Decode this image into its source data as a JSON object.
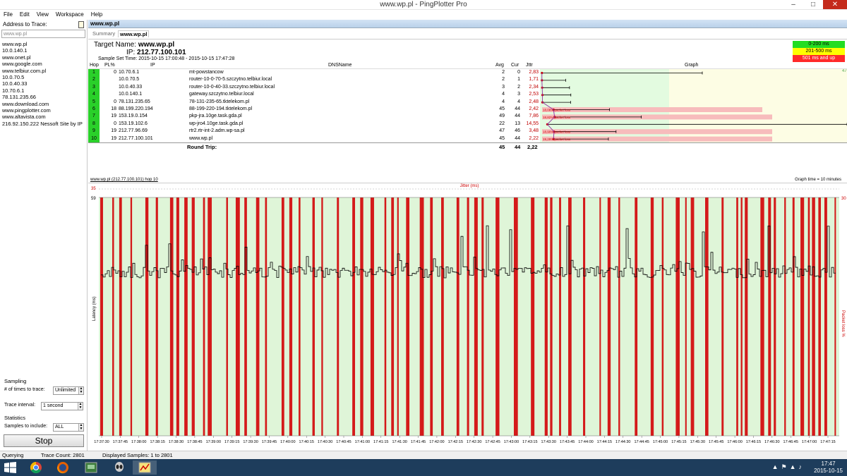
{
  "window": {
    "title": "www.wp.pl - PingPlotter Pro"
  },
  "menu": [
    "File",
    "Edit",
    "View",
    "Workspace",
    "Help"
  ],
  "left": {
    "header": "Address to Trace:",
    "address_value": "www.wp.pl",
    "history": [
      "www.wp.pl",
      "10.0.140.1",
      "www.onet.pl",
      "www.google.com",
      "www.telbiur.com.pl",
      "10.0.70.5",
      "10.0.40.33",
      "10.70.6.1",
      "78.131.235.66",
      "www.download.com",
      "www.pingplotter.com",
      "www.altavista.com",
      "216.92.150.222 Nessoft Site by IP"
    ],
    "sampling_label": "Sampling",
    "times_label": "# of times to trace:",
    "times_value": "Unlimited",
    "interval_label": "Trace interval:",
    "interval_value": "1 second",
    "statistics_label": "Statistics",
    "samples_label": "Samples to include:",
    "samples_value": "ALL",
    "stop_label": "Stop"
  },
  "main": {
    "tab_title": "www.wp.pl",
    "subtab_summary": "Summary",
    "subtab_target": "www.wp.pl",
    "target_name_label": "Target Name:",
    "target_name": "www.wp.pl",
    "ip_label": "IP:",
    "ip": "212.77.100.101",
    "sample_set_label": "Sample Set Time:",
    "sample_set_time": "2015-10-15 17:00:48 - 2015-10-15 17:47:28",
    "legend": [
      {
        "label": "0-200 ms",
        "color": "#22dd22"
      },
      {
        "label": "201-500 ms",
        "color": "#ffff00"
      },
      {
        "label": "501 ms and up",
        "color": "#ff2a2a"
      }
    ],
    "columns": {
      "hop": "Hop",
      "pl": "PL%",
      "ip": "IP",
      "dns": "DNSName",
      "avg": "Avg",
      "cur": "Cur",
      "jttr": "Jttr",
      "graph": "Graph"
    },
    "graph_scale_max": "471",
    "hops": [
      {
        "hop": "1",
        "pl": "0",
        "ip": "10.70.6.1",
        "dns": "mt-powstancow",
        "avg": "2",
        "cur": "0",
        "jttr": "2,83",
        "loss_note": ""
      },
      {
        "hop": "2",
        "pl": "",
        "ip": "10.0.70.5",
        "dns": "router-10-0-70-5.szczytno.telbiur.local",
        "avg": "2",
        "cur": "1",
        "jttr": "1,71",
        "loss_note": ""
      },
      {
        "hop": "3",
        "pl": "",
        "ip": "10.0.40.33",
        "dns": "router-10-0-40-33.szczytno.telbiur.local",
        "avg": "3",
        "cur": "2",
        "jttr": "2,34",
        "loss_note": ""
      },
      {
        "hop": "4",
        "pl": "",
        "ip": "10.0.140.1",
        "dns": "gateway.szczytno.telbiur.local",
        "avg": "4",
        "cur": "3",
        "jttr": "2,53",
        "loss_note": ""
      },
      {
        "hop": "5",
        "pl": "0",
        "ip": "78.131.235.65",
        "dns": "78-131-235-65.tktelekom.pl",
        "avg": "4",
        "cur": "4",
        "jttr": "2,48",
        "loss_note": ""
      },
      {
        "hop": "6",
        "pl": "18",
        "ip": "88.199.220.194",
        "dns": "88-199-220-194.tktelekom.pl",
        "avg": "45",
        "cur": "44",
        "jttr": "2,42",
        "loss_note": "18,08% packet loss"
      },
      {
        "hop": "7",
        "pl": "19",
        "ip": "153.19.0.154",
        "dns": "pkp-jra.10ge.task.gda.pl",
        "avg": "49",
        "cur": "44",
        "jttr": "7,86",
        "loss_note": "18,82% packet loss"
      },
      {
        "hop": "8",
        "pl": "0",
        "ip": "153.19.102.6",
        "dns": "wp-jro4.10ge.task.gda.pl",
        "avg": "22",
        "cur": "13",
        "jttr": "14,55",
        "loss_note": ""
      },
      {
        "hop": "9",
        "pl": "19",
        "ip": "212.77.96.69",
        "dns": "rtr2.rtr-int-2.adm.wp-sa.pl",
        "avg": "47",
        "cur": "46",
        "jttr": "3,48",
        "loss_note": "18,90% packet loss"
      },
      {
        "hop": "10",
        "pl": "19",
        "ip": "212.77.100.101",
        "dns": "www.wp.pl",
        "avg": "45",
        "cur": "44",
        "jttr": "2,22",
        "loss_note": "19,29% packet loss"
      }
    ],
    "round_trip": {
      "label": "Round Trip:",
      "avg": "45",
      "cur": "44",
      "jttr": "2,22"
    }
  },
  "bottom_graph": {
    "title": "www.wp.pl (212.77.100.101) hop 10",
    "graph_time": "Graph time = 10 minutes",
    "jitter_label": "Jitter (ms)",
    "jitter_max": "35",
    "latency_max": "59",
    "y_left_label": "Latency (ms)",
    "y_right_label": "Packet loss %",
    "right_max": "30",
    "times": [
      "17:37:30",
      "17:37:45",
      "17:38:00",
      "17:38:15",
      "17:38:30",
      "17:38:45",
      "17:39:00",
      "17:39:15",
      "17:39:30",
      "17:39:45",
      "17:40:00",
      "17:40:15",
      "17:40:30",
      "17:40:45",
      "17:41:00",
      "17:41:15",
      "17:41:30",
      "17:41:45",
      "17:42:00",
      "17:42:15",
      "17:42:30",
      "17:42:45",
      "17:43:00",
      "17:43:15",
      "17:43:30",
      "17:43:45",
      "17:44:00",
      "17:44:15",
      "17:44:30",
      "17:44:45",
      "17:45:00",
      "17:45:15",
      "17:45:30",
      "17:45:45",
      "17:46:00",
      "17:46:15",
      "17:46:30",
      "17:46:45",
      "17:47:00",
      "17:47:15"
    ]
  },
  "status": {
    "querying": "Querying",
    "trace_count": "Trace Count: 2801",
    "displayed": "Displayed Samples: 1 to 2801"
  },
  "taskbar": {
    "time": "17:47",
    "date": "2015-10-15"
  }
}
